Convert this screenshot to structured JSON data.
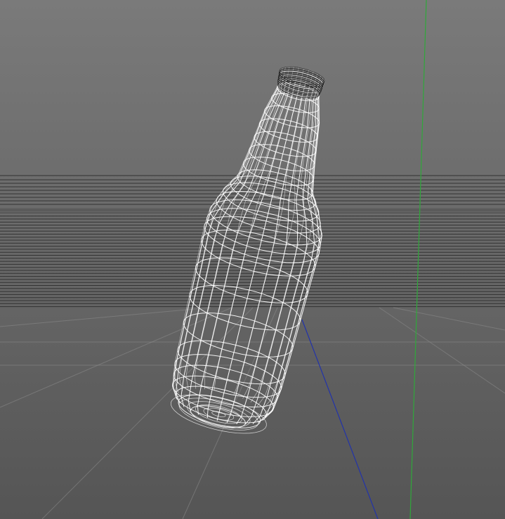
{
  "viewport": {
    "view_mode": "wireframe",
    "shading": "wireframe",
    "colors": {
      "background_top": "#7a7a7a",
      "background_bottom": "#555555",
      "horizon_lines": "#2a2a2a",
      "grid_lines": "#8c8c8c",
      "wireframe": "#ffffff",
      "wireframe_dark": "#111111",
      "axis_y": "#2fa83a",
      "axis_z": "#2233aa"
    }
  },
  "scene": {
    "objects": [
      {
        "name": "bottle",
        "type": "mesh",
        "display": "wireframe"
      }
    ],
    "axes": [
      "y-axis",
      "z-axis"
    ]
  }
}
